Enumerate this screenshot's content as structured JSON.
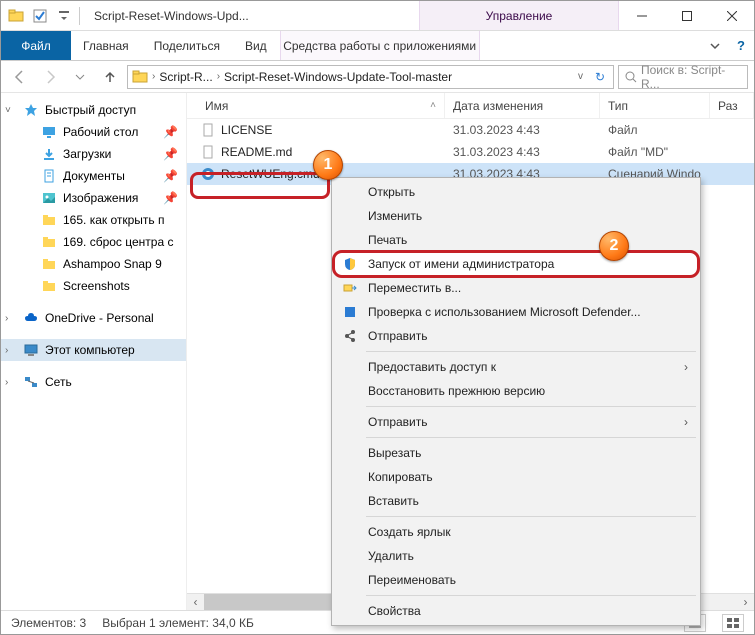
{
  "titlebar": {
    "title": "Script-Reset-Windows-Upd...",
    "manage": "Управление"
  },
  "ribbon": {
    "file": "Файл",
    "home": "Главная",
    "share": "Поделиться",
    "view": "Вид",
    "tools": "Средства работы с приложениями"
  },
  "addr": {
    "crumbs": [
      "Script-R...",
      "Script-Reset-Windows-Update-Tool-master"
    ],
    "search_placeholder": "Поиск в: Script-R..."
  },
  "nav": {
    "quick": "Быстрый доступ",
    "desktop": "Рабочий стол",
    "downloads": "Загрузки",
    "documents": "Документы",
    "pictures": "Изображения",
    "f165": "165. как открыть п",
    "f169": "169. сброс центра с",
    "ashampoo": "Ashampoo Snap 9",
    "screenshots": "Screenshots",
    "onedrive": "OneDrive - Personal",
    "thispc": "Этот компьютер",
    "network": "Сеть"
  },
  "cols": {
    "name": "Имя",
    "date": "Дата изменения",
    "type": "Тип",
    "size": "Раз"
  },
  "files": [
    {
      "name": "LICENSE",
      "date": "31.03.2023 4:43",
      "type": "Файл"
    },
    {
      "name": "README.md",
      "date": "31.03.2023 4:43",
      "type": "Файл \"MD\""
    },
    {
      "name": "ResetWUEng.cmd",
      "date": "31.03.2023 4:43",
      "type": "Сценарий Windo"
    }
  ],
  "ctx": {
    "open": "Открыть",
    "edit": "Изменить",
    "print": "Печать",
    "runas": "Запуск от имени администратора",
    "moveto": "Переместить в...",
    "defender": "Проверка с использованием Microsoft Defender...",
    "sendto": "Отправить",
    "giveaccess": "Предоставить доступ к",
    "restore": "Восстановить прежнюю версию",
    "sendto2": "Отправить",
    "cut": "Вырезать",
    "copy": "Копировать",
    "paste": "Вставить",
    "shortcut": "Создать ярлык",
    "delete": "Удалить",
    "rename": "Переименовать",
    "props": "Свойства"
  },
  "status": {
    "items": "Элементов: 3",
    "selected": "Выбран 1 элемент: 34,0 КБ"
  },
  "badges": {
    "b1": "1",
    "b2": "2"
  }
}
